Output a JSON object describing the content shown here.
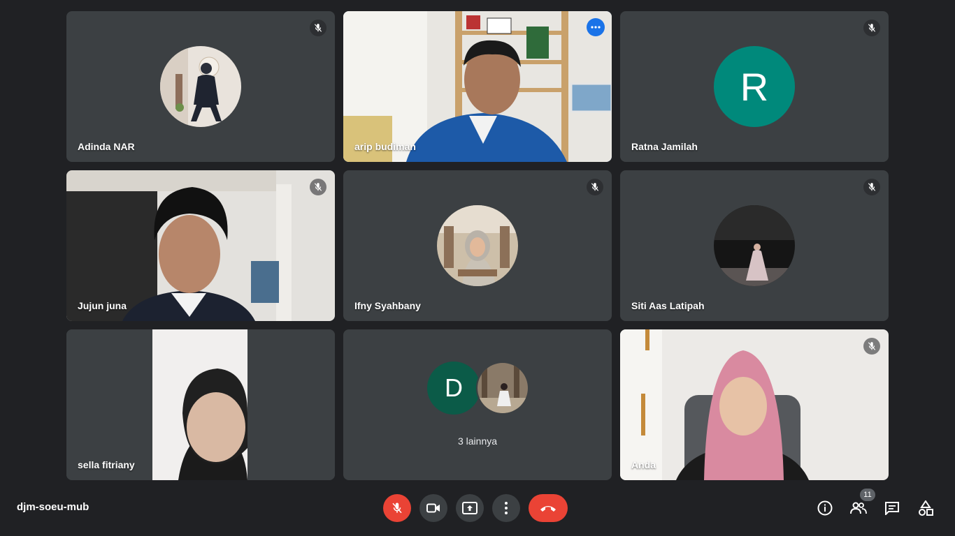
{
  "participants": [
    {
      "name": "Adinda NAR",
      "muted": true,
      "display": "photo-avatar"
    },
    {
      "name": "arip budiman",
      "muted": false,
      "display": "video",
      "active_speaker": true
    },
    {
      "name": "Ratna Jamilah",
      "muted": true,
      "display": "letter-avatar",
      "initial": "R",
      "avatar_color": "#00897b"
    },
    {
      "name": "Jujun juna",
      "muted": true,
      "display": "video"
    },
    {
      "name": "Ifny Syahbany",
      "muted": true,
      "display": "photo-avatar"
    },
    {
      "name": "Siti Aas Latipah",
      "muted": true,
      "display": "photo-avatar"
    },
    {
      "name": "sella fitriany",
      "muted": false,
      "display": "video"
    },
    {
      "name": "Anda",
      "muted": true,
      "display": "video"
    }
  ],
  "others_tile": {
    "initial": "D",
    "label": "3 lainnya"
  },
  "meeting": {
    "code": "djm-soeu-mub"
  },
  "people_count": "11",
  "controls": [
    "mic-off-icon",
    "camera-icon",
    "present-screen-icon",
    "more-options-icon",
    "end-call-icon"
  ],
  "side_panel_icons": [
    "info-icon",
    "people-icon",
    "chat-icon",
    "activities-icon"
  ],
  "colors": {
    "background": "#202124",
    "tile": "#3c4043",
    "accent_blue": "#1a73e8",
    "danger_red": "#ea4335"
  }
}
